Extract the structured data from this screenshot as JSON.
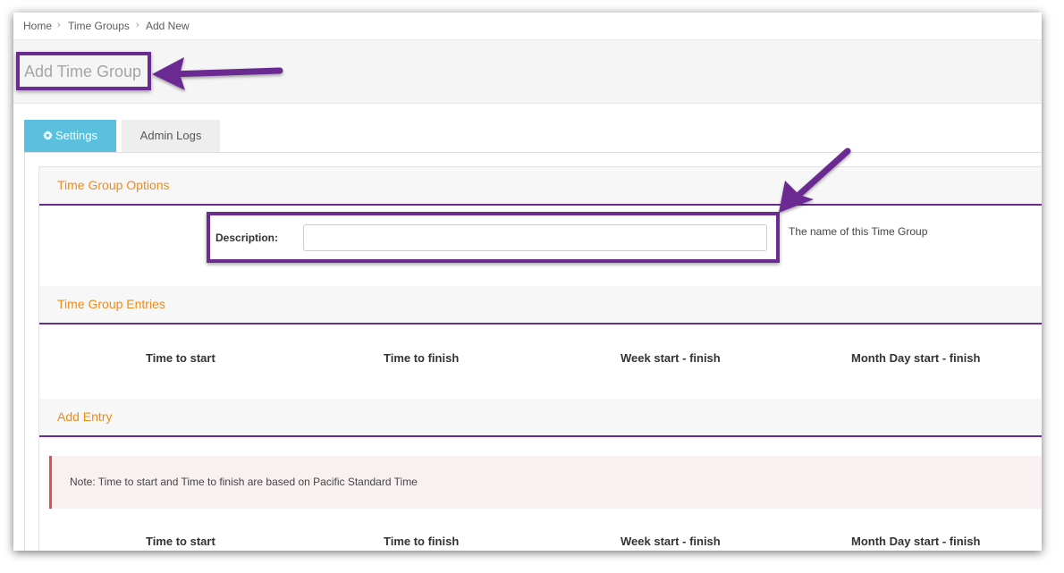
{
  "breadcrumb": {
    "home": "Home",
    "time_groups": "Time Groups",
    "add_new": "Add New",
    "separator": "›"
  },
  "page_title": "Add Time Group",
  "tabs": {
    "settings": "Settings",
    "settings_icon": "gear-icon",
    "admin_logs": "Admin Logs"
  },
  "options": {
    "heading": "Time Group Options",
    "description_label": "Description:",
    "description_value": "",
    "description_help": "The name of this Time Group"
  },
  "entries": {
    "heading": "Time Group Entries",
    "columns": [
      "Time to start",
      "Time to finish",
      "Week start - finish",
      "Month Day start - finish"
    ]
  },
  "add_entry": {
    "heading": "Add Entry",
    "note": "Note: Time to start and Time to finish are based on Pacific Standard Time",
    "columns": [
      "Time to start",
      "Time to finish",
      "Week start - finish",
      "Month Day start - finish"
    ]
  },
  "colors": {
    "accent": "#6b2c91",
    "section_heading": "#ef8c17",
    "active_tab": "#5bc0de",
    "note_border": "#d9534f"
  }
}
